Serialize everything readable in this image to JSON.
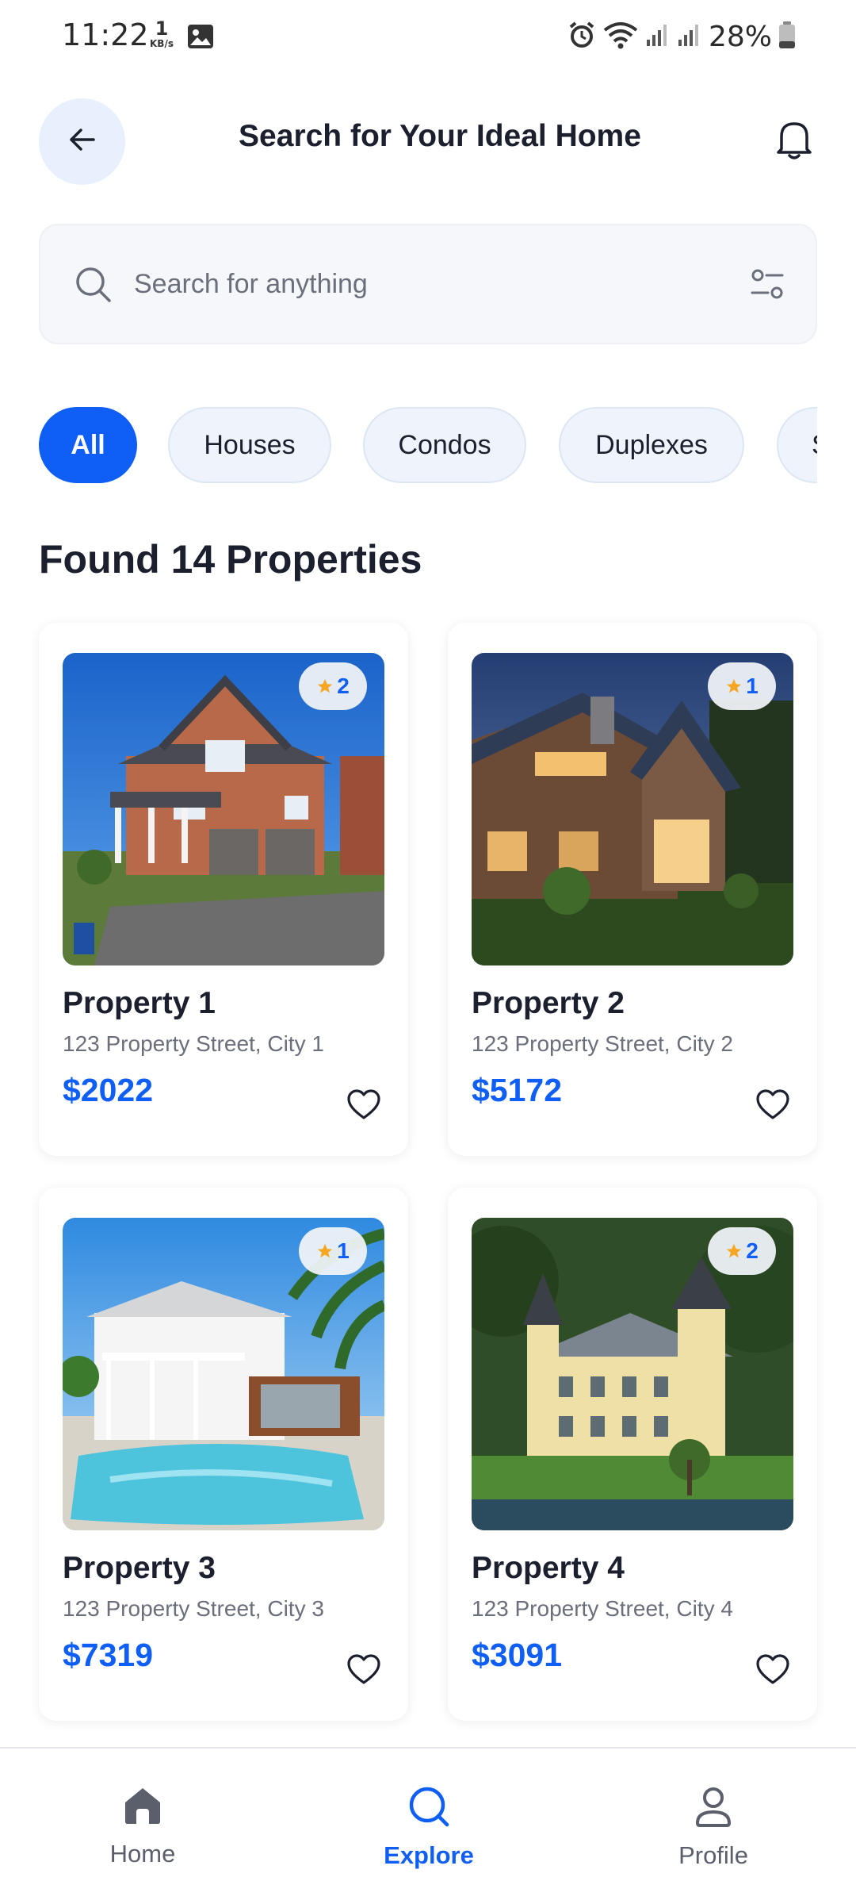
{
  "status_bar": {
    "time": "11:22",
    "speed_value": "1",
    "speed_unit": "KB/s",
    "battery": "28%"
  },
  "header": {
    "title": "Search for Your Ideal Home",
    "back_icon": "arrow-left-icon",
    "notification_icon": "bell-icon"
  },
  "search": {
    "placeholder": "Search for anything",
    "value": ""
  },
  "categories": [
    {
      "label": "All",
      "active": true
    },
    {
      "label": "Houses",
      "active": false
    },
    {
      "label": "Condos",
      "active": false
    },
    {
      "label": "Duplexes",
      "active": false
    },
    {
      "label": "S",
      "active": false
    }
  ],
  "results_title": "Found 14 Properties",
  "properties": [
    {
      "name": "Property 1",
      "address": "123 Property Street, City 1",
      "price": "$2022",
      "rating": "2"
    },
    {
      "name": "Property 2",
      "address": "123 Property Street, City 2",
      "price": "$5172",
      "rating": "1"
    },
    {
      "name": "Property 3",
      "address": "123 Property Street, City 3",
      "price": "$7319",
      "rating": "1"
    },
    {
      "name": "Property 4",
      "address": "123 Property Street, City 4",
      "price": "$3091",
      "rating": "2"
    }
  ],
  "nav": [
    {
      "label": "Home",
      "icon": "home-icon",
      "active": false
    },
    {
      "label": "Explore",
      "icon": "search-icon",
      "active": true
    },
    {
      "label": "Profile",
      "icon": "user-icon",
      "active": false
    }
  ],
  "colors": {
    "accent": "#0f5ef5",
    "star": "#f5a623",
    "text": "#1b1f2e",
    "muted": "#6b6f7b"
  }
}
